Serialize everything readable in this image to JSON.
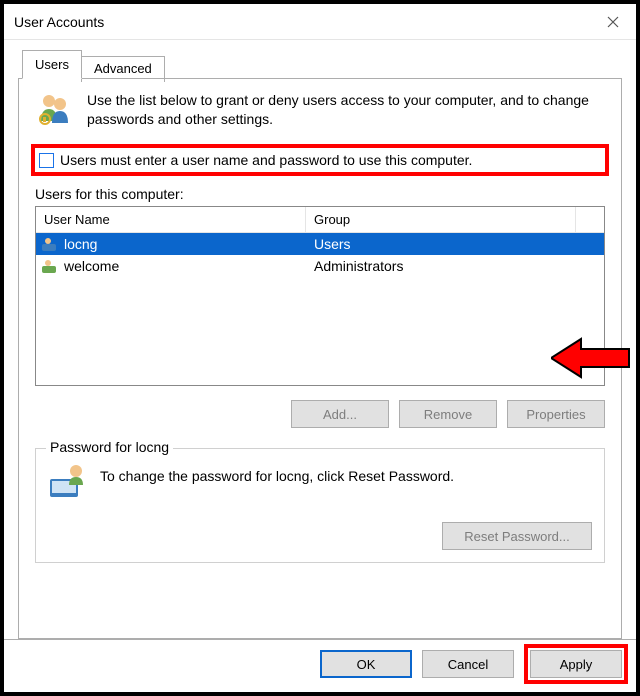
{
  "window": {
    "title": "User Accounts"
  },
  "tabs": {
    "active": "Users",
    "others": [
      "Advanced"
    ]
  },
  "intro_text": "Use the list below to grant or deny users access to your computer, and to change passwords and other settings.",
  "checkbox": {
    "label": "Users must enter a user name and password to use this computer.",
    "checked": false
  },
  "users_section_label": "Users for this computer:",
  "list": {
    "columns": {
      "name": "User Name",
      "group": "Group"
    },
    "rows": [
      {
        "name": "locng",
        "group": "Users",
        "selected": true
      },
      {
        "name": "welcome",
        "group": "Administrators",
        "selected": false
      }
    ]
  },
  "list_buttons": {
    "add": "Add...",
    "remove": "Remove",
    "properties": "Properties"
  },
  "password_box": {
    "legend": "Password for locng",
    "text": "To change the password for locng, click Reset Password.",
    "button": "Reset Password..."
  },
  "footer": {
    "ok": "OK",
    "cancel": "Cancel",
    "apply": "Apply"
  }
}
